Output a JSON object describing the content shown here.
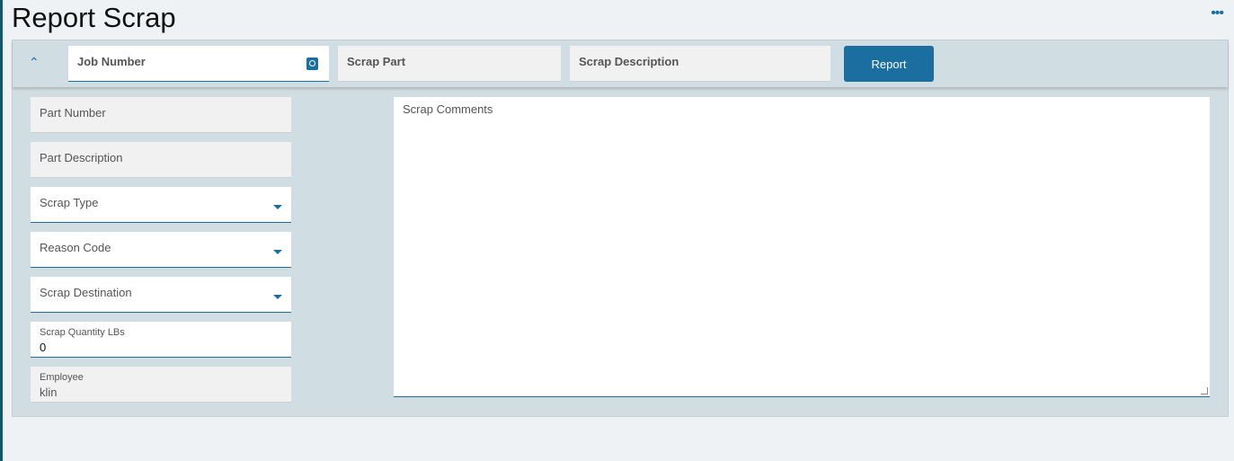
{
  "title": "Report Scrap",
  "more_icon": "•••",
  "header": {
    "job_number": "Job Number",
    "scrap_part": "Scrap Part",
    "scrap_description": "Scrap Description",
    "report": "Report"
  },
  "fields": {
    "part_number": "Part Number",
    "part_description": "Part Description",
    "scrap_type": "Scrap Type",
    "reason_code": "Reason Code",
    "scrap_destination": "Scrap Destination",
    "scrap_quantity_label": "Scrap Quantity LBs",
    "scrap_quantity_value": "0",
    "employee_label": "Employee",
    "employee_value": "klin"
  },
  "comments": {
    "label": "Scrap Comments"
  },
  "colors": {
    "accent": "#1a6fa0",
    "panel": "#d0dde2"
  }
}
